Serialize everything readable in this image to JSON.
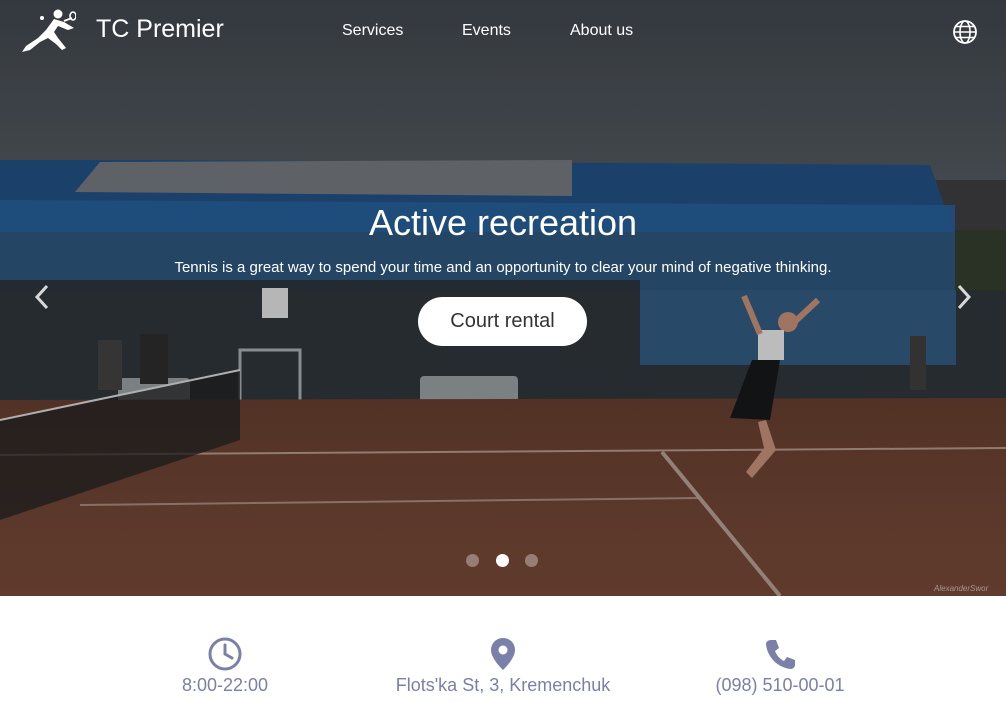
{
  "header": {
    "brand": "TC Premier",
    "nav": [
      {
        "label": "Services"
      },
      {
        "label": "Events"
      },
      {
        "label": "About us"
      }
    ]
  },
  "hero": {
    "title": "Active recreation",
    "text": "Tennis is a great way to spend your time and an opportunity to clear your mind of negative thinking.",
    "button_label": "Court rental",
    "watermark": "AlexanderSwor",
    "active_slide": 2,
    "slide_count": 3
  },
  "info": {
    "hours": "8:00-22:00",
    "address": "Flots'ka St, 3, Kremenchuk",
    "phone": "(098) 510-00-01"
  },
  "colors": {
    "info_accent": "#7b80a8",
    "button_bg": "#ffffff",
    "dot_active": "#ffffff"
  },
  "icons": [
    "tennis-player-logo-icon",
    "globe-icon",
    "chevron-left-icon",
    "chevron-right-icon",
    "clock-icon",
    "location-pin-icon",
    "phone-icon"
  ]
}
